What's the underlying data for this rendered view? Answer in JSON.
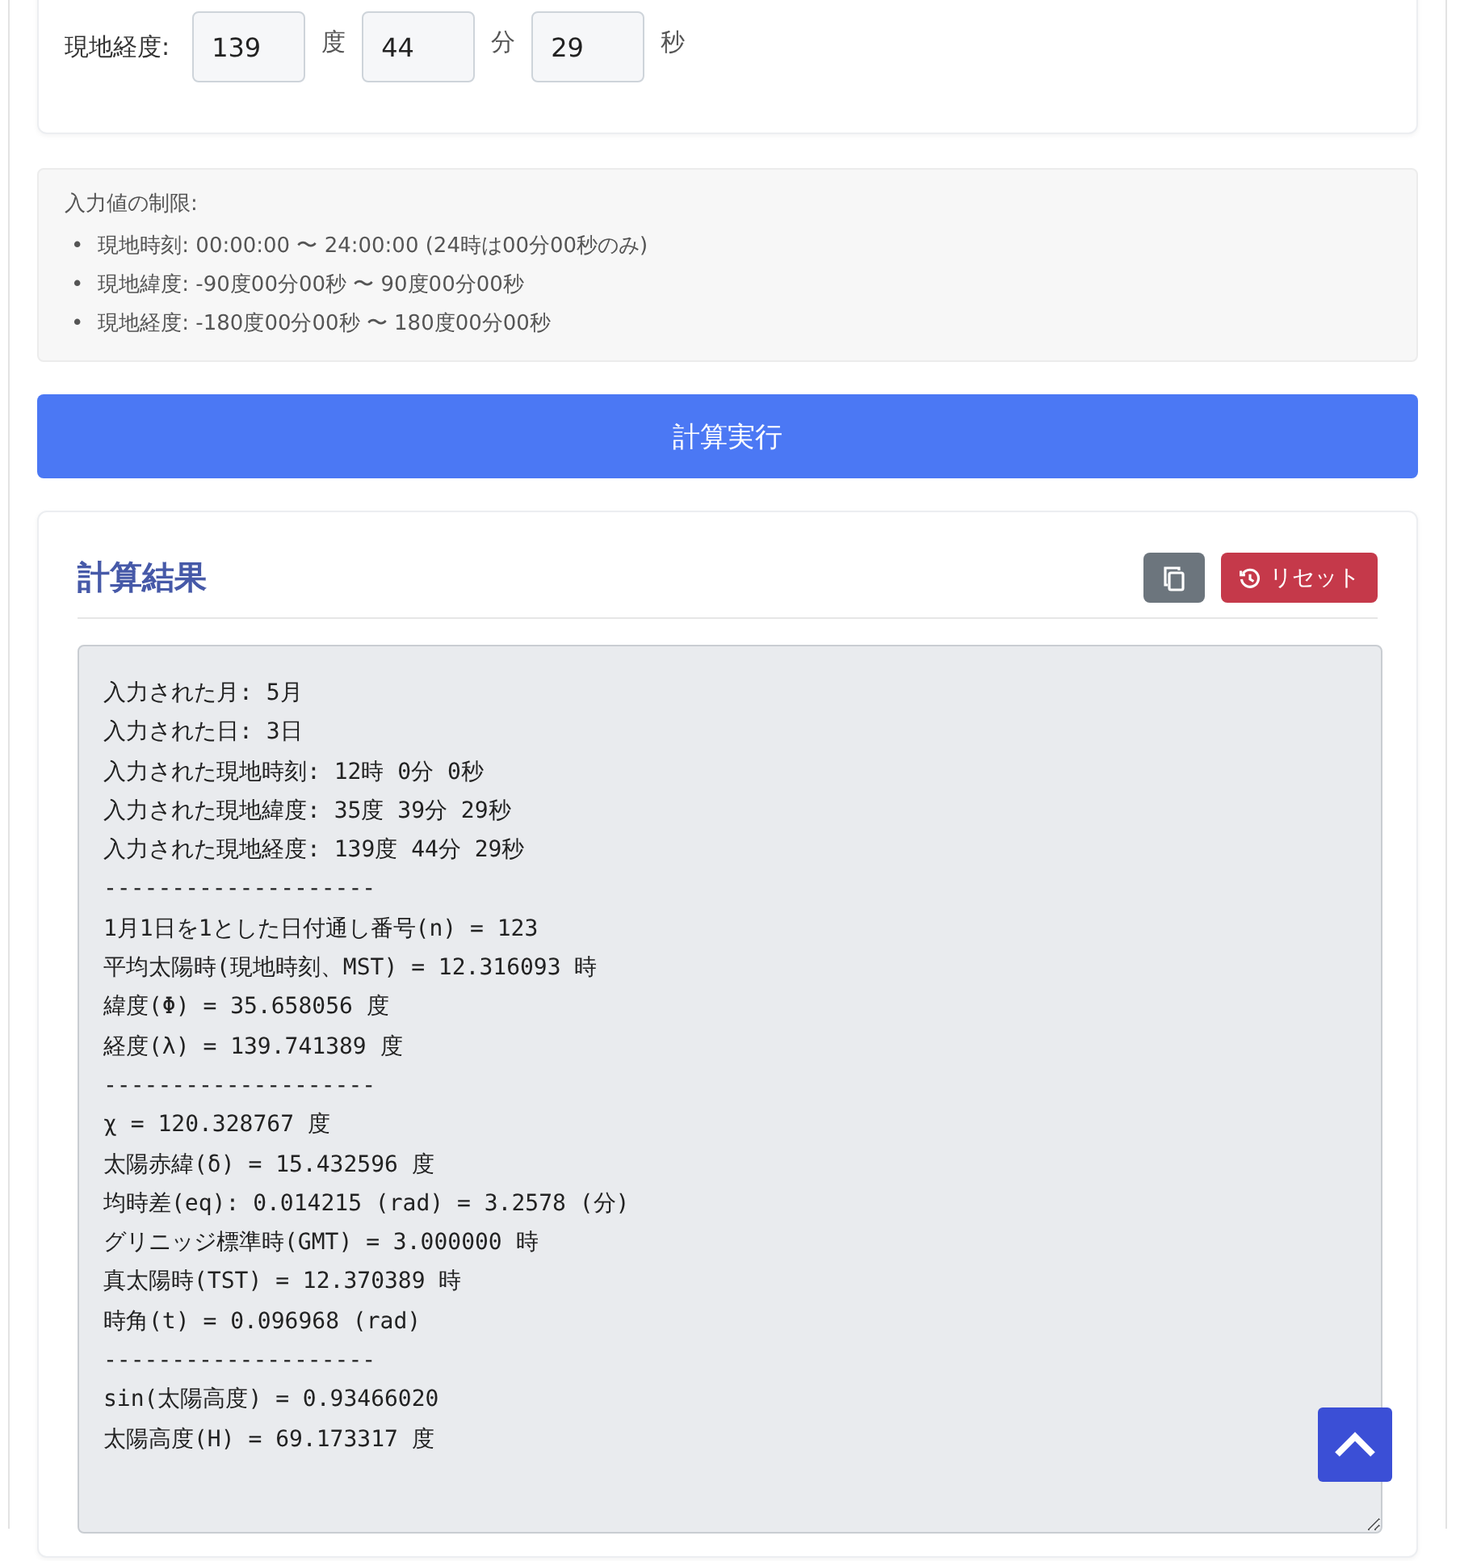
{
  "longitude": {
    "label": "現地経度:",
    "fields": [
      {
        "value": "139",
        "unit": "度"
      },
      {
        "value": "44",
        "unit": "分"
      },
      {
        "value": "29",
        "unit": "秒"
      }
    ]
  },
  "limits": {
    "title": "入力値の制限:",
    "items": [
      {
        "marker": "•",
        "text": "現地時刻: 00:00:00 〜 24:00:00 (24時は00分00秒のみ)"
      },
      {
        "marker": "•",
        "text": "現地緯度: -90度00分00秒 〜 90度00分00秒"
      },
      {
        "marker": "•",
        "text": "現地経度: -180度00分00秒 〜 180度00分00秒"
      }
    ]
  },
  "run_button": "計算実行",
  "result": {
    "title": "計算結果",
    "reset_label": "リセット",
    "lines": [
      "入力された月: 5月",
      "入力された日: 3日",
      "入力された現地時刻: 12時 0分 0秒",
      "入力された現地緯度: 35度 39分 29秒",
      "入力された現地経度: 139度 44分 29秒",
      "--------------------",
      "1月1日を1とした日付通し番号(n) = 123",
      "平均太陽時(現地時刻、MST) = 12.316093 時",
      "緯度(Φ) = 35.658056 度",
      "経度(λ) = 139.741389 度",
      "--------------------",
      "χ = 120.328767 度",
      "太陽赤緯(δ) = 15.432596 度",
      "均時差(eq): 0.014215 (rad) = 3.2578 (分)",
      "グリニッジ標準時(GMT) = 3.000000 時",
      "真太陽時(TST) = 12.370389 時",
      "時角(t) = 0.096968 (rad)",
      "--------------------",
      "sin(太陽高度) = 0.93466020",
      "太陽高度(H) = 69.173317 度"
    ]
  }
}
